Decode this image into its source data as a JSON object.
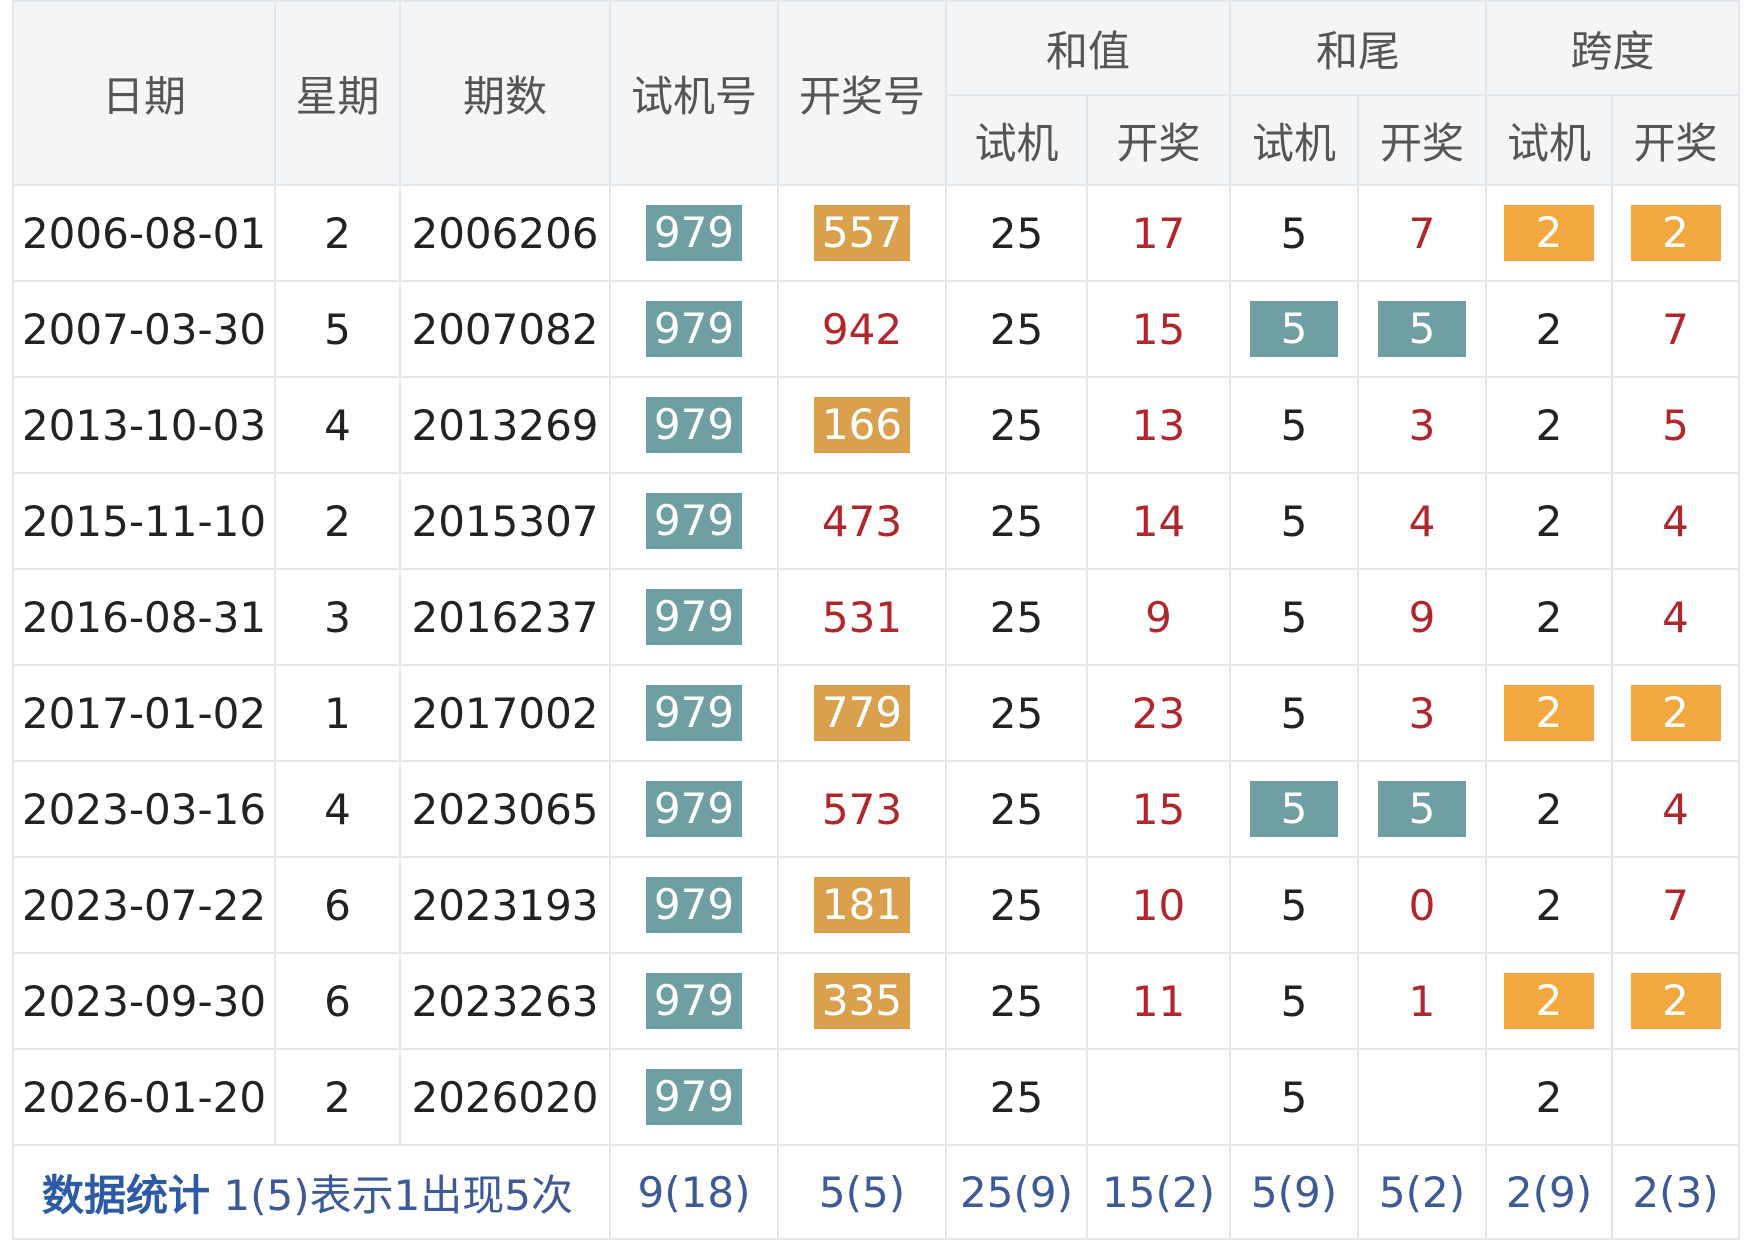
{
  "headers": {
    "date": "日期",
    "weekday": "星期",
    "issue": "期数",
    "test_no": "试机号",
    "draw_no": "开奖号",
    "sum_group": "和值",
    "tail_group": "和尾",
    "span_group": "跨度",
    "sub_test": "试机",
    "sub_draw": "开奖"
  },
  "colors": {
    "teal": "#6f9fa3",
    "tan": "#d9a14e",
    "orange": "#f3a73f",
    "red_text": "#b2262b",
    "stat_blue": "#3c5a96"
  },
  "rows": [
    {
      "date": "2006-08-01",
      "weekday": "2",
      "issue": "2006206",
      "test_no": "979",
      "draw_no": "557",
      "draw_style": "tan",
      "sum_test": "25",
      "sum_draw": "17",
      "tail_test": "5",
      "tail_draw": "7",
      "tail_style": "plain",
      "span_test": "2",
      "span_draw": "2",
      "span_style": "orange"
    },
    {
      "date": "2007-03-30",
      "weekday": "5",
      "issue": "2007082",
      "test_no": "979",
      "draw_no": "942",
      "draw_style": "red",
      "sum_test": "25",
      "sum_draw": "15",
      "tail_test": "5",
      "tail_draw": "5",
      "tail_style": "teal",
      "span_test": "2",
      "span_draw": "7",
      "span_style": "plain"
    },
    {
      "date": "2013-10-03",
      "weekday": "4",
      "issue": "2013269",
      "test_no": "979",
      "draw_no": "166",
      "draw_style": "tan",
      "sum_test": "25",
      "sum_draw": "13",
      "tail_test": "5",
      "tail_draw": "3",
      "tail_style": "plain",
      "span_test": "2",
      "span_draw": "5",
      "span_style": "plain"
    },
    {
      "date": "2015-11-10",
      "weekday": "2",
      "issue": "2015307",
      "test_no": "979",
      "draw_no": "473",
      "draw_style": "red",
      "sum_test": "25",
      "sum_draw": "14",
      "tail_test": "5",
      "tail_draw": "4",
      "tail_style": "plain",
      "span_test": "2",
      "span_draw": "4",
      "span_style": "plain"
    },
    {
      "date": "2016-08-31",
      "weekday": "3",
      "issue": "2016237",
      "test_no": "979",
      "draw_no": "531",
      "draw_style": "red",
      "sum_test": "25",
      "sum_draw": "9",
      "tail_test": "5",
      "tail_draw": "9",
      "tail_style": "plain",
      "span_test": "2",
      "span_draw": "4",
      "span_style": "plain"
    },
    {
      "date": "2017-01-02",
      "weekday": "1",
      "issue": "2017002",
      "test_no": "979",
      "draw_no": "779",
      "draw_style": "tan",
      "sum_test": "25",
      "sum_draw": "23",
      "tail_test": "5",
      "tail_draw": "3",
      "tail_style": "plain",
      "span_test": "2",
      "span_draw": "2",
      "span_style": "orange"
    },
    {
      "date": "2023-03-16",
      "weekday": "4",
      "issue": "2023065",
      "test_no": "979",
      "draw_no": "573",
      "draw_style": "red",
      "sum_test": "25",
      "sum_draw": "15",
      "tail_test": "5",
      "tail_draw": "5",
      "tail_style": "teal",
      "span_test": "2",
      "span_draw": "4",
      "span_style": "plain"
    },
    {
      "date": "2023-07-22",
      "weekday": "6",
      "issue": "2023193",
      "test_no": "979",
      "draw_no": "181",
      "draw_style": "tan",
      "sum_test": "25",
      "sum_draw": "10",
      "tail_test": "5",
      "tail_draw": "0",
      "tail_style": "plain",
      "span_test": "2",
      "span_draw": "7",
      "span_style": "plain"
    },
    {
      "date": "2023-09-30",
      "weekday": "6",
      "issue": "2023263",
      "test_no": "979",
      "draw_no": "335",
      "draw_style": "tan",
      "sum_test": "25",
      "sum_draw": "11",
      "tail_test": "5",
      "tail_draw": "1",
      "tail_style": "plain",
      "span_test": "2",
      "span_draw": "2",
      "span_style": "orange"
    },
    {
      "date": "2026-01-20",
      "weekday": "2",
      "issue": "2026020",
      "test_no": "979",
      "draw_no": "",
      "draw_style": "none",
      "sum_test": "25",
      "sum_draw": "",
      "tail_test": "5",
      "tail_draw": "",
      "tail_style": "plain",
      "span_test": "2",
      "span_draw": "",
      "span_style": "plain"
    }
  ],
  "stats": {
    "label_bold": "数据统计",
    "label_note": "1(5)表示1出现5次",
    "test_no": "9(18)",
    "draw_no": "5(5)",
    "sum_test": "25(9)",
    "sum_draw": "15(2)",
    "tail_test": "5(9)",
    "tail_draw": "5(2)",
    "span_test": "2(9)",
    "span_draw": "2(3)"
  }
}
